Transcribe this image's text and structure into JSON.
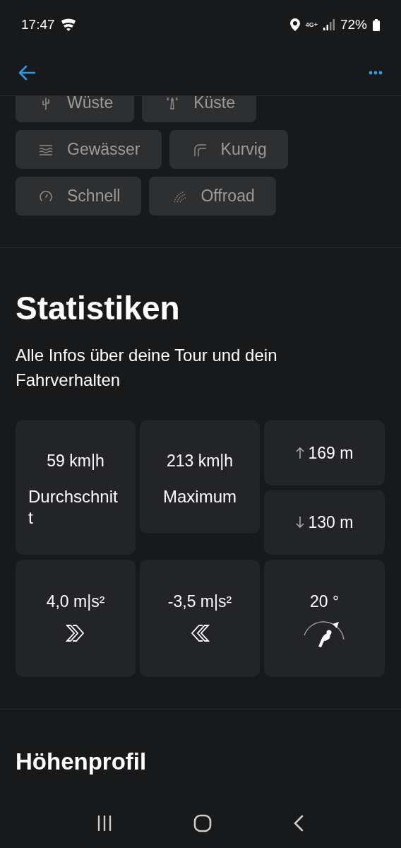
{
  "status_bar": {
    "time": "17:47",
    "network": "4G+",
    "battery": "72%"
  },
  "chips": [
    {
      "label": "Wüste"
    },
    {
      "label": "Küste"
    },
    {
      "label": "Gewässer"
    },
    {
      "label": "Kurvig"
    },
    {
      "label": "Schnell"
    },
    {
      "label": "Offroad"
    }
  ],
  "statistics": {
    "title": "Statistiken",
    "subtitle": "Alle Infos über deine Tour und dein Fahrverhalten",
    "tiles": [
      {
        "kind": "metric",
        "value": "59 km|h",
        "label": "Durchschnitt"
      },
      {
        "kind": "metric",
        "value": "213 km|h",
        "label": "Maximum"
      },
      {
        "kind": "elevation",
        "up": "169 m",
        "down": "130 m"
      },
      {
        "kind": "accel",
        "value": "4,0 m|s²",
        "braking": false
      },
      {
        "kind": "accel",
        "value": "-3,5 m|s²",
        "braking": true
      },
      {
        "kind": "lean",
        "value": "20 °"
      }
    ]
  },
  "elevation_profile": {
    "title": "Höhenprofil"
  }
}
